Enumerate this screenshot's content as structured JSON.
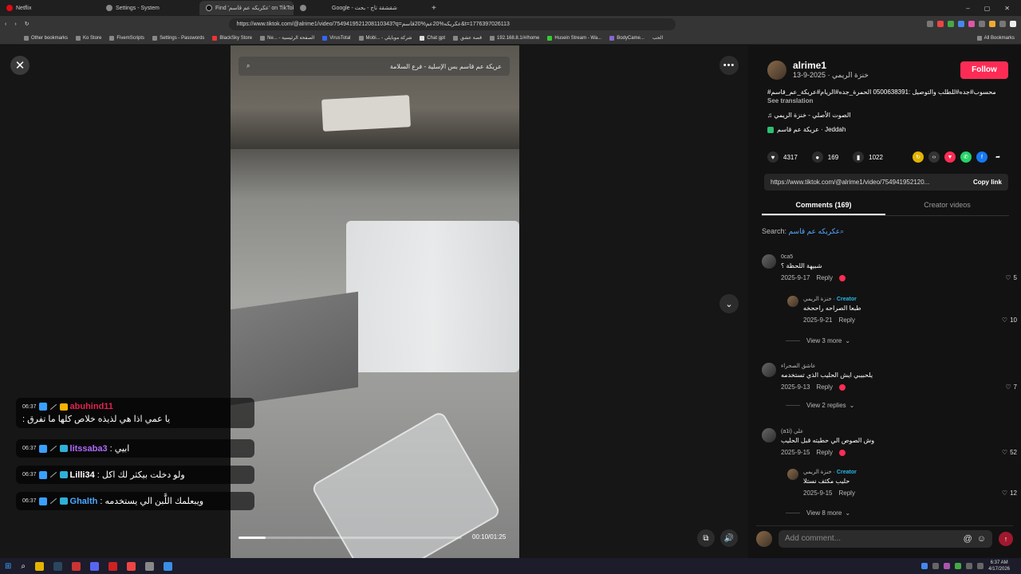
{
  "browser": {
    "tabs": [
      {
        "title": "Netflix"
      },
      {
        "title": "Settings - System"
      },
      {
        "title": "Find 'عكريكه عم قاسم' on TikTok",
        "active": true
      },
      {
        "title": ""
      },
      {
        "title": "Google - شقشقة تاج - بحث"
      }
    ],
    "url": "https://www.tiktok.com/@alrime1/video/7549419521208110343?q=عكريكه%20عم%20قاسم&t=1776397026113",
    "bookmarks": [
      "Other bookmarks",
      "Ko Store",
      "FivemScripts",
      "Settings - Passwords",
      "BlackSky Store",
      "Ne... - الصفحة الرئيسية",
      "VirusTotal",
      "Mobi... - شركة موبايلي",
      "Chat gpt",
      "قصة عشق",
      "192.168.8.1/#/home",
      "Husein Stream - Wa...",
      "BodyCame...",
      "الحب"
    ],
    "all_bookmarks": "All Bookmarks"
  },
  "video": {
    "search_text": "عريكة عم قاسم بس الإسلية - فرع السلامة",
    "time": "00:10/01:25",
    "progress": 0.12
  },
  "chat": [
    {
      "time": "06:37",
      "user": "abuhind11",
      "color": "#e0244e",
      "badge_color": "#f5b400",
      "msg": "يا عمي اذا هي لذيذه خلاص كلها ما تفرق :"
    },
    {
      "time": "06:37",
      "user": "litssaba3",
      "color": "#b06cff",
      "badge_color": "#2fb0d8",
      "msg": "ابيي :"
    },
    {
      "time": "06:37",
      "user": "Lilli34",
      "color": "#ffffff",
      "badge_color": "#2fb0d8",
      "msg": "ولو دخلت بيكثر لك اكل :"
    },
    {
      "time": "06:37",
      "user": "Ghalth",
      "color": "#4aa8ff",
      "badge_color": "#2fb0d8",
      "msg": "ويبعلمك اللَّبن الي يستخدمه :"
    }
  ],
  "panel": {
    "author": "alrime1",
    "author_sub": "خنزة الريمي · 2025-9-13",
    "follow": "Follow",
    "description": "محسوب#جده#للطلب والتوصيل :0500638391 الحمرة_جده#الريام#عريكة_عم_قاسم#",
    "see_translation": "See translation",
    "music": "الصوت الأصلي - خنزة الريمي",
    "location": "عريكة عم قاسم · Jeddah",
    "likes": "4317",
    "comments_count": "169",
    "saves": "1022",
    "link": "https://www.tiktok.com/@alrime1/video/754941952120...",
    "copy_link": "Copy link",
    "tab_comments": "Comments (169)",
    "tab_creator": "Creator videos",
    "search_label": "Search:",
    "search_query": "عكريكه عم قاسم",
    "comments": [
      {
        "user": "0ca5",
        "text": "شبيهة اللحظة ؟",
        "date": "2025-9-17",
        "likes": "5"
      },
      {
        "user": "خنزة الريمي",
        "creator": "Creator",
        "text": "طبعا الصراحه راححخه",
        "date": "2025-9-21",
        "likes": "10"
      },
      {
        "view_more": "View 3 more"
      },
      {
        "user": "عاشق الصحراء",
        "text": "يلحبيبي ايش الحليب الذي تستخدمه",
        "date": "2025-9-13",
        "likes": "7"
      },
      {
        "view_more": "View 2 replies"
      },
      {
        "user": "(a1i) علي",
        "text": "وش الصوص الي حطيته قبل الحليب",
        "date": "2025-9-15",
        "likes": "52"
      },
      {
        "user": "خنزة الريمي",
        "creator": "Creator",
        "text": "حليب مكثف نستلا",
        "date": "2025-9-15",
        "likes": "12"
      },
      {
        "view_more": "View 8 more"
      }
    ],
    "reply": "Reply",
    "add_comment": "Add comment..."
  },
  "taskbar": {
    "time": "6:37 AM",
    "date": "4/17/2026"
  }
}
